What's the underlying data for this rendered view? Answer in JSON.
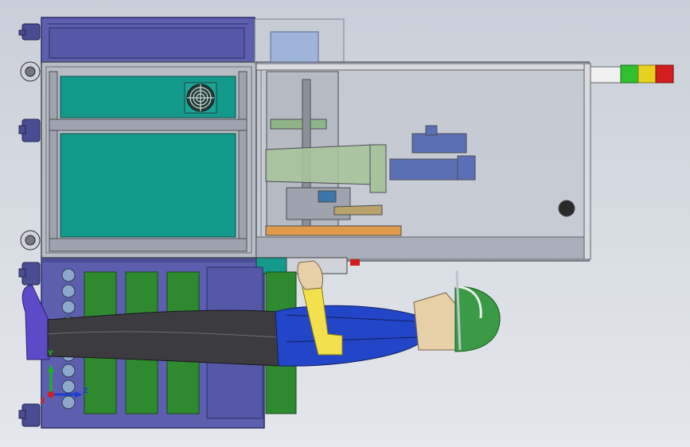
{
  "window": {
    "title": ""
  },
  "triad": {
    "x_label": "X",
    "y_label": "Y",
    "z_label": "Z"
  },
  "colors": {
    "background_top": "#c9cfd8",
    "frame_purple": "#5c5fae",
    "frame_purple_dark": "#3c3f86",
    "panel_teal": "#139a8a",
    "battery_green": "#2f8a2f",
    "profile_gray": "#b7bcc5",
    "figure_blue": "#2346c8",
    "figure_yellow": "#f2e04c",
    "helmet_green": "#3a9a45",
    "trousers": "#3c3c40",
    "boot": "#5b4bc8",
    "lamp_white": "#f0f0f0",
    "lamp_green": "#2fbf2f",
    "lamp_yellow": "#e6d21e",
    "lamp_red": "#d21e1e",
    "axis_x": "#d11d1d",
    "axis_y": "#1bb51b",
    "axis_z": "#1d3ed1"
  },
  "icons": {
    "fan": "fan-icon",
    "stack_light": "signal-tower-icon",
    "casters": "caster-wheel-icon",
    "triad": "coordinate-triad-icon"
  }
}
